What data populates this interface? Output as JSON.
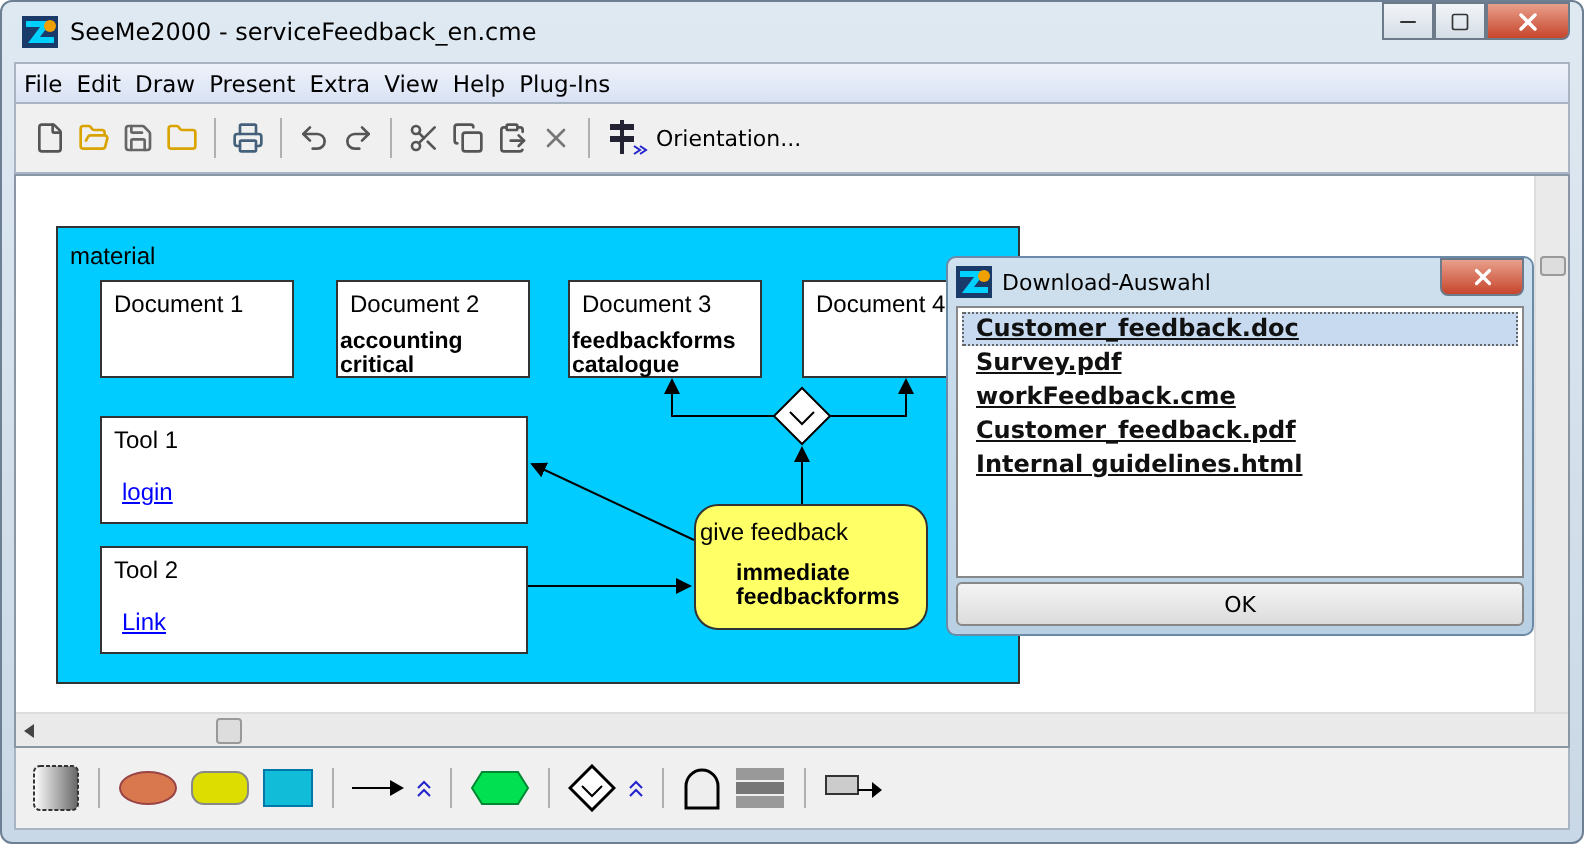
{
  "window": {
    "title": "SeeMe2000 - serviceFeedback_en.cme"
  },
  "menu": [
    "File",
    "Edit",
    "Draw",
    "Present",
    "Extra",
    "View",
    "Help",
    "Plug-Ins"
  ],
  "toolbar": {
    "orientation_button": "Orientation..."
  },
  "diagram": {
    "group": "material",
    "documents": [
      {
        "title": "Document 1"
      },
      {
        "title": "Document 2",
        "body": [
          "accounting",
          "critical"
        ]
      },
      {
        "title": "Document 3",
        "body": [
          "feedbackforms",
          "catalogue"
        ]
      },
      {
        "title": "Document 4"
      }
    ],
    "tools": [
      {
        "title": "Tool 1",
        "link": "login"
      },
      {
        "title": "Tool 2",
        "link": "Link"
      }
    ],
    "activity": {
      "title": "give feedback",
      "body": [
        "immediate",
        "feedbackforms"
      ]
    }
  },
  "dialog": {
    "title": "Download-Auswahl",
    "files": [
      {
        "name": "Customer_feedback.doc",
        "selected": true
      },
      {
        "name": "Survey.pdf",
        "selected": false
      },
      {
        "name": "workFeedback.cme",
        "selected": false
      },
      {
        "name": "Customer_feedback.pdf",
        "selected": false
      },
      {
        "name": "Internal guidelines.html",
        "selected": false
      }
    ],
    "ok": "OK"
  }
}
